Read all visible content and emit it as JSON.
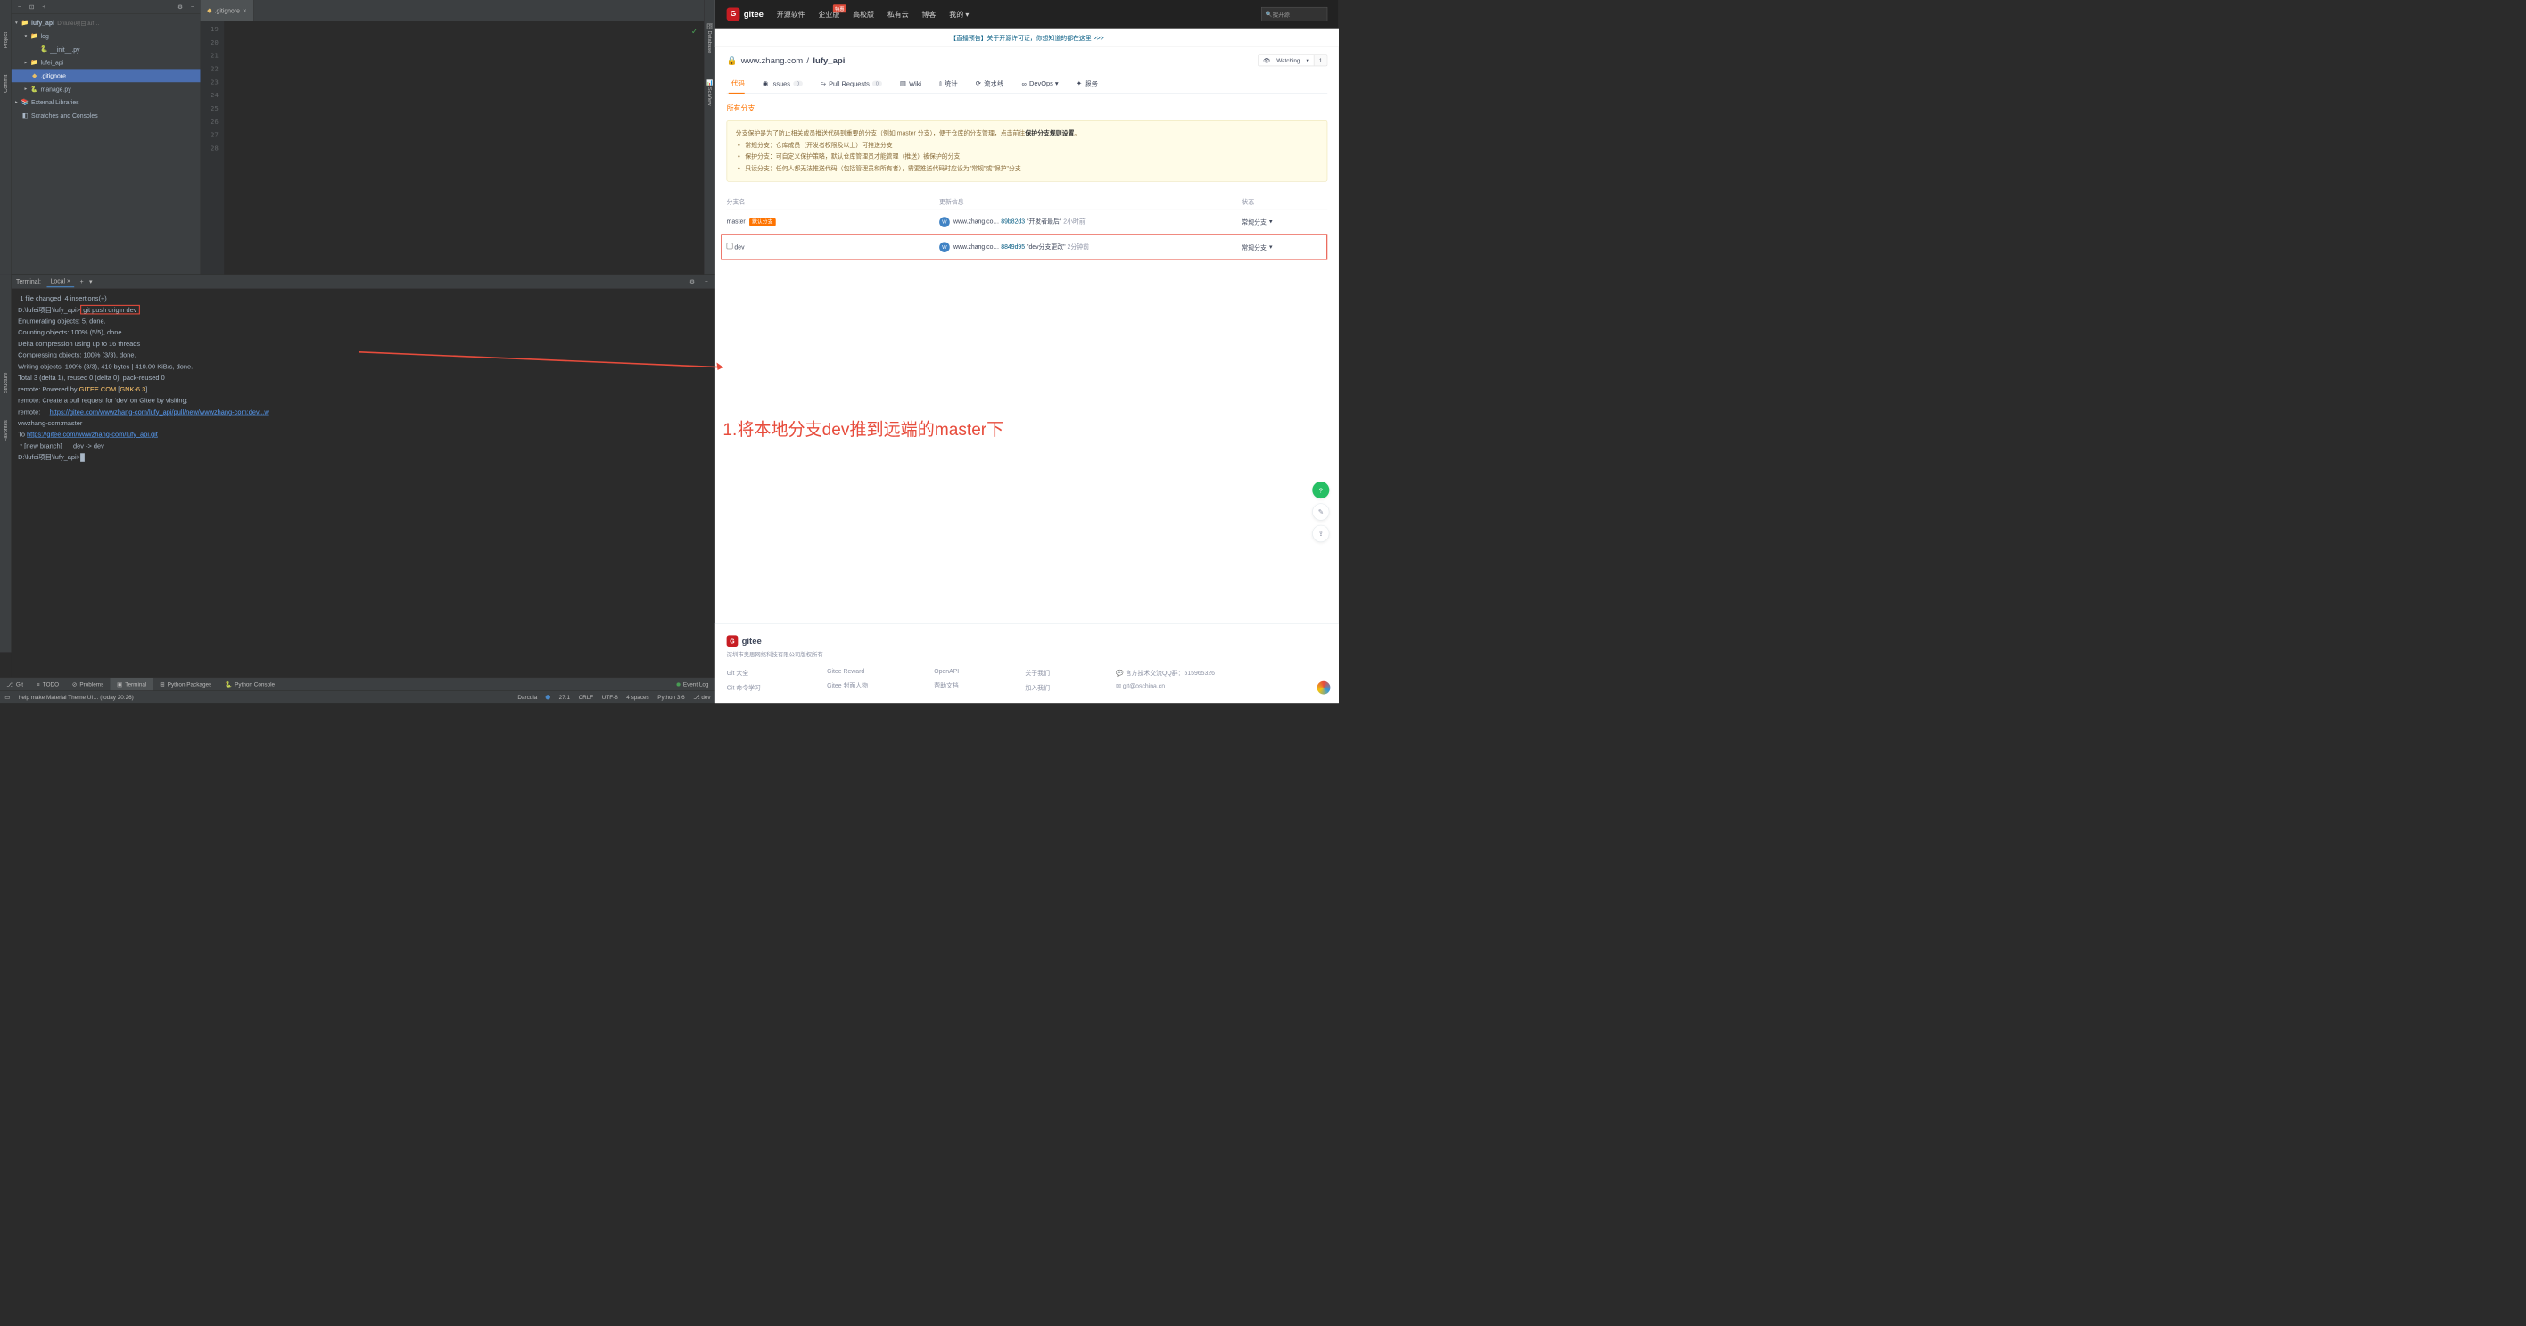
{
  "ide": {
    "sideTabs": {
      "project": "Project",
      "commit": "Commit",
      "structure": "Structure",
      "favorites": "Favorites"
    },
    "sideTabsRight": {
      "database": "Database",
      "sciview": "SciView"
    },
    "panelHeaderIcons": [
      "−",
      "⊡",
      "÷",
      "⚙",
      "−"
    ],
    "project": {
      "root": {
        "name": "lufy_api",
        "path": "D:\\lufei项目\\luf…"
      },
      "items": [
        {
          "name": "log",
          "level": 1,
          "arrow": "▾",
          "icon": "📁"
        },
        {
          "name": "__init__.py",
          "level": 2,
          "arrow": "",
          "icon": "🐍"
        },
        {
          "name": "lufei_api",
          "level": 1,
          "arrow": "▸",
          "icon": "📁"
        },
        {
          "name": ".gitignore",
          "level": 1,
          "arrow": "",
          "icon": "◆",
          "selected": true
        },
        {
          "name": "manage.py",
          "level": 1,
          "arrow": "▸",
          "icon": "🐍"
        },
        {
          "name": "External Libraries",
          "level": 0,
          "arrow": "▸",
          "icon": "📚"
        },
        {
          "name": "Scratches and Consoles",
          "level": 0,
          "arrow": "",
          "icon": "◧"
        }
      ]
    },
    "editor": {
      "tab": ".gitignore",
      "gutterStart": 19,
      "gutterEnd": 28
    },
    "terminal": {
      "label": "Terminal:",
      "tab": "Local",
      "lines": [
        " 1 file changed, 4 insertions(+)",
        "",
        {
          "prompt": "D:\\lufei项目\\lufy_api>",
          "cmd": "git push origin dev"
        },
        "Enumerating objects: 5, done.",
        "Counting objects: 100% (5/5), done.",
        "Delta compression using up to 16 threads",
        "Compressing objects: 100% (3/3), done.",
        "Writing objects: 100% (3/3), 410 bytes | 410.00 KiB/s, done.",
        "Total 3 (delta 1), reused 0 (delta 0), pack-reused 0",
        {
          "pre": "remote: Powered by ",
          "yellow": "GITEE.COM",
          "post": " [",
          "yellow2": "GNK-6.3",
          "post2": "]"
        },
        "remote: Create a pull request for 'dev' on Gitee by visiting:",
        {
          "pre": "remote:     ",
          "link": "https://gitee.com/wwwzhang-com/lufy_api/pull/new/wwwzhang-com:dev...w"
        },
        "wwzhang-com:master",
        {
          "pre": "To ",
          "link": "https://gitee.com/wwwzhang-com/lufy_api.git"
        },
        " * [new branch]      dev -> dev",
        "",
        {
          "prompt": "D:\\lufei项目\\lufy_api>",
          "cursor": true
        }
      ]
    },
    "toolWindows": [
      {
        "label": "Git",
        "icon": "⎇"
      },
      {
        "label": "TODO",
        "icon": "≡"
      },
      {
        "label": "Problems",
        "icon": "⊘"
      },
      {
        "label": "Terminal",
        "icon": "▣",
        "active": true
      },
      {
        "label": "Python Packages",
        "icon": "⊞"
      },
      {
        "label": "Python Console",
        "icon": "🐍"
      },
      {
        "label": "Event Log",
        "icon": "●",
        "right": true
      }
    ],
    "status": {
      "msg": "help make Material Theme UI… (today 20:26)",
      "theme": "Darcula",
      "pos": "27:1",
      "eol": "CRLF",
      "enc": "UTF-8",
      "indent": "4 spaces",
      "python": "Python 3.6",
      "branch": "dev"
    }
  },
  "gitee": {
    "logo": "gitee",
    "nav": [
      "开源软件",
      "企业版",
      "高校版",
      "私有云",
      "博客",
      "我的"
    ],
    "navBadge": "特惠",
    "searchPlaceholder": "搜开源",
    "notice": "【直播预告】关于开源许可证，你想知道的都在这里 >>>",
    "owner": "www.zhang.com",
    "repo": "lufy_api",
    "watch": {
      "label": "Watching",
      "count": "1"
    },
    "tabs": [
      {
        "label": "代码",
        "active": true,
        "icon": "</>"
      },
      {
        "label": "Issues",
        "count": "0",
        "icon": "◉"
      },
      {
        "label": "Pull Requests",
        "count": "0",
        "icon": "⥲"
      },
      {
        "label": "Wiki",
        "icon": "▤"
      },
      {
        "label": "统计",
        "icon": "⫾"
      },
      {
        "label": "流水线",
        "icon": "⟳"
      },
      {
        "label": "DevOps",
        "icon": "∞",
        "chevron": true
      },
      {
        "label": "服务",
        "icon": "✦"
      }
    ],
    "sectionTitle": "所有分支",
    "infoBox": {
      "intro": "分支保护是为了防止相关成员推送代码到重要的分支（例如 master 分支），便于仓库的分支管理，点击前往",
      "link": "保护分支规则设置",
      "bullets": [
        "常规分支：仓库成员（开发者权限及以上）可推送分支",
        "保护分支：可自定义保护策略，默认仓库管理员才能管理（推送）被保护的分支",
        "只读分支：任何人都无法推送代码（包括管理员和所有者），需要推送代码时应设为\"常规\"或\"保护\"分支"
      ]
    },
    "branchTable": {
      "headers": {
        "name": "分支名",
        "update": "更新信息",
        "status": "状态"
      },
      "rows": [
        {
          "name": "master",
          "default": "默认分支",
          "avatar": "W",
          "user": "www.zhang.co…",
          "hash": "89b82d3",
          "msg": "\"开发者最后\"",
          "time": "2小时前",
          "status": "常规分支"
        },
        {
          "name": "dev",
          "checkbox": true,
          "avatar": "W",
          "user": "www.zhang.co…",
          "hash": "8849d95",
          "msg": "\"dev分支更改\"",
          "time": "2分钟前",
          "status": "常规分支",
          "highlight": true
        }
      ]
    },
    "annotation": "1.将本地分支dev推到远端的master下",
    "footer": {
      "logo": "gitee",
      "copy": "深圳市奥思网络科技有限公司版权所有",
      "cols": [
        [
          "Git 大全",
          "Git 命令学习"
        ],
        [
          "Gitee Reward",
          "Gitee 封面人物"
        ],
        [
          "OpenAPI",
          "帮助文档"
        ],
        [
          "关于我们",
          "加入我们"
        ],
        [
          "官方技术交流QQ群：515965326",
          "git@oschina.cn"
        ]
      ]
    }
  }
}
